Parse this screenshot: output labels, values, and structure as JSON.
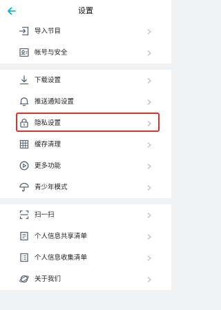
{
  "header": {
    "title": "设置",
    "back_icon": "arrow-left-icon"
  },
  "colors": {
    "icon": "#5a6370",
    "accent_back": "#00a6c9",
    "highlight_border": "#e0302a",
    "chevron": "#b9bcc2"
  },
  "groups": [
    {
      "items": [
        {
          "label": "导入节目",
          "icon": "import-icon"
        },
        {
          "label": "帐号与安全",
          "icon": "account-security-icon"
        }
      ]
    },
    {
      "items": [
        {
          "label": "下载设置",
          "icon": "download-icon"
        },
        {
          "label": "推送通知设置",
          "icon": "bell-icon"
        },
        {
          "label": "隐私设置",
          "icon": "lock-icon",
          "highlighted": true
        },
        {
          "label": "缓存清理",
          "icon": "grid-icon"
        },
        {
          "label": "更多功能",
          "icon": "play-circle-icon"
        },
        {
          "label": "青少年模式",
          "icon": "umbrella-icon"
        }
      ]
    },
    {
      "items": [
        {
          "label": "扫一扫",
          "icon": "scan-icon"
        },
        {
          "label": "个人信息共享清单",
          "icon": "document-icon"
        },
        {
          "label": "个人信息收集清单",
          "icon": "document-list-icon"
        },
        {
          "label": "关于我们",
          "icon": "planet-icon"
        }
      ]
    }
  ]
}
